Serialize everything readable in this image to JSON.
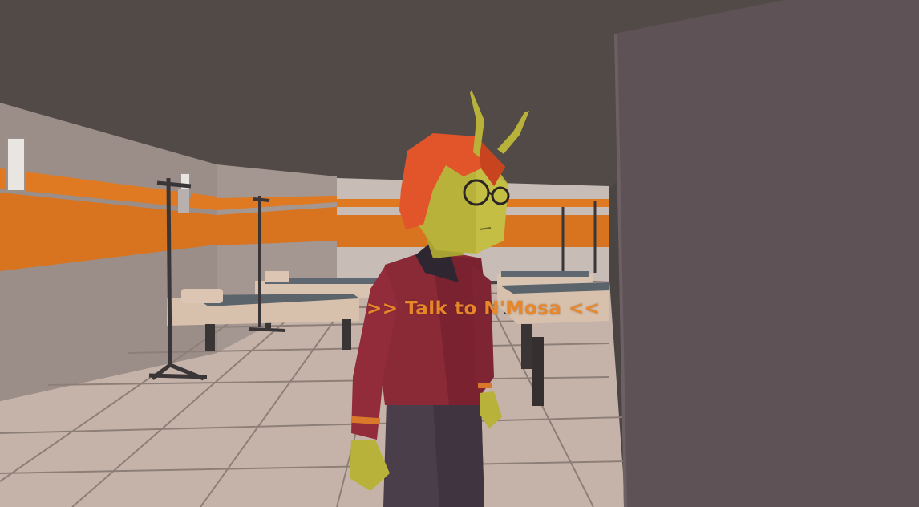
{
  "interaction_prompt": {
    "text": ">> Talk to N'Mosa <<",
    "color": "#e8862a"
  },
  "scene": {
    "wall_stripe_color": "#e07a22",
    "uniform_color": "#8a2a36",
    "hair_color": "#e2542a",
    "skin_color": "#b8b23a"
  }
}
